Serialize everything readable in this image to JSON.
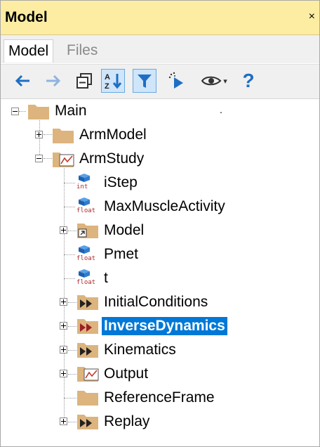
{
  "panel": {
    "title": "Model",
    "close_glyph": "×"
  },
  "tabs": [
    {
      "label": "Model",
      "active": true
    },
    {
      "label": "Files",
      "active": false
    }
  ],
  "toolbar": {
    "buttons": [
      {
        "name": "back-arrow-icon"
      },
      {
        "name": "forward-arrow-icon"
      },
      {
        "name": "collapse-all-icon"
      },
      {
        "name": "sort-az-icon",
        "text": "A Z",
        "toggled": true
      },
      {
        "name": "filter-icon",
        "toggled": true
      },
      {
        "name": "run-cursor-icon"
      },
      {
        "name": "eye-icon",
        "dropdown": "▾"
      },
      {
        "name": "help-icon",
        "text": "?"
      }
    ]
  },
  "tree": {
    "root": {
      "label": "Main",
      "dot": "."
    },
    "armmodel": {
      "label": "ArmModel"
    },
    "armstudy": {
      "label": "ArmStudy"
    },
    "istep": {
      "label": "iStep",
      "type": "int"
    },
    "maxmuscle": {
      "label": "MaxMuscleActivity",
      "type": "float"
    },
    "model": {
      "label": "Model"
    },
    "pmet": {
      "label": "Pmet",
      "type": "float"
    },
    "t": {
      "label": "t",
      "type": "float"
    },
    "initialconditions": {
      "label": "InitialConditions"
    },
    "inversedynamics": {
      "label": "InverseDynamics",
      "selected": true
    },
    "kinematics": {
      "label": "Kinematics"
    },
    "output": {
      "label": "Output"
    },
    "referenceframe": {
      "label": "ReferenceFrame"
    },
    "replay": {
      "label": "Replay"
    }
  },
  "colors": {
    "title_bg": "#fdeda3",
    "accent_blue": "#1e6fc4",
    "selection": "#0078d7",
    "folder": "#ddb47e",
    "type_red": "#b0292c"
  }
}
